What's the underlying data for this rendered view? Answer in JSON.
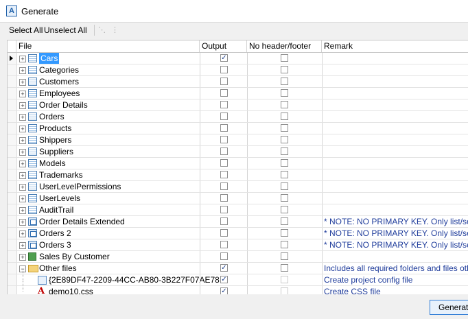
{
  "window": {
    "title": "Generate",
    "app_icon_letter": "A"
  },
  "toolbar": {
    "select_all": "Select All",
    "unselect_all": "Unselect All"
  },
  "columns": {
    "file": "File",
    "output": "Output",
    "no_header_footer": "No header/footer",
    "remark": "Remark"
  },
  "rows": [
    {
      "name": "Cars",
      "icon": "table-icon",
      "output": true,
      "nhf": false,
      "remark": "",
      "selected": true
    },
    {
      "name": "Categories",
      "icon": "table-icon",
      "output": false,
      "nhf": false,
      "remark": ""
    },
    {
      "name": "Customers",
      "icon": "table-icon",
      "output": false,
      "nhf": false,
      "remark": ""
    },
    {
      "name": "Employees",
      "icon": "table-icon",
      "output": false,
      "nhf": false,
      "remark": ""
    },
    {
      "name": "Order Details",
      "icon": "table-icon",
      "output": false,
      "nhf": false,
      "remark": ""
    },
    {
      "name": "Orders",
      "icon": "table-icon",
      "output": false,
      "nhf": false,
      "remark": ""
    },
    {
      "name": "Products",
      "icon": "table-icon",
      "output": false,
      "nhf": false,
      "remark": ""
    },
    {
      "name": "Shippers",
      "icon": "table-icon",
      "output": false,
      "nhf": false,
      "remark": ""
    },
    {
      "name": "Suppliers",
      "icon": "table-icon",
      "output": false,
      "nhf": false,
      "remark": ""
    },
    {
      "name": "Models",
      "icon": "table-icon",
      "output": false,
      "nhf": false,
      "remark": ""
    },
    {
      "name": "Trademarks",
      "icon": "table-icon",
      "output": false,
      "nhf": false,
      "remark": ""
    },
    {
      "name": "UserLevelPermissions",
      "icon": "table-icon",
      "output": false,
      "nhf": false,
      "remark": ""
    },
    {
      "name": "UserLevels",
      "icon": "table-icon",
      "output": false,
      "nhf": false,
      "remark": ""
    },
    {
      "name": "AuditTrail",
      "icon": "table-icon",
      "output": false,
      "nhf": false,
      "remark": ""
    },
    {
      "name": "Order Details Extended",
      "icon": "view-icon",
      "output": false,
      "nhf": false,
      "remark": "* NOTE: NO PRIMARY KEY. Only list/search"
    },
    {
      "name": "Orders 2",
      "icon": "view-icon",
      "output": false,
      "nhf": false,
      "remark": "* NOTE: NO PRIMARY KEY. Only list/search"
    },
    {
      "name": "Orders 3",
      "icon": "view-icon",
      "output": false,
      "nhf": false,
      "remark": "* NOTE: NO PRIMARY KEY. Only list/search"
    },
    {
      "name": "Sales By Customer",
      "icon": "report-icon",
      "output": false,
      "nhf": false,
      "remark": ""
    },
    {
      "name": "Other files",
      "icon": "folder-icon",
      "output": true,
      "nhf": false,
      "remark": "Includes all required folders and files other t",
      "expanded": true
    },
    {
      "name": "{2E89DF47-2209-44CC-AB80-3B227F07AE78",
      "icon": "config-icon",
      "output": true,
      "nhf": false,
      "nhf_disabled": true,
      "remark": "Create project config file",
      "child": true
    },
    {
      "name": "demo10.css",
      "icon": "css-icon",
      "output": true,
      "nhf": false,
      "nhf_disabled": true,
      "remark": "Create CSS file",
      "child": true
    }
  ],
  "footer": {
    "generate_label": "Generate"
  }
}
